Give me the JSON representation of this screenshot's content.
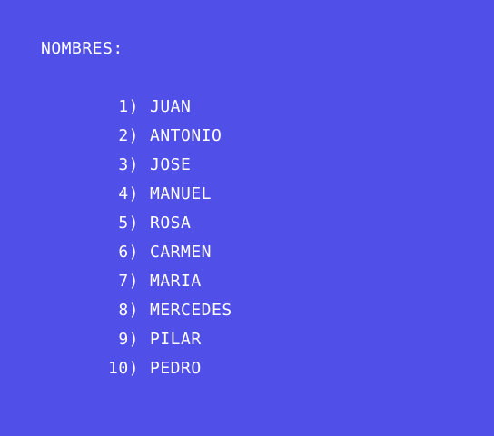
{
  "screen": {
    "heading": "NOMBRES:",
    "background_color": "#5050e8",
    "text_color": "#ffffff"
  },
  "names": [
    {
      "index": "1)",
      "name": "JUAN"
    },
    {
      "index": "2)",
      "name": "ANTONIO"
    },
    {
      "index": "3)",
      "name": "JOSE"
    },
    {
      "index": "4)",
      "name": "MANUEL"
    },
    {
      "index": "5)",
      "name": "ROSA"
    },
    {
      "index": "6)",
      "name": "CARMEN"
    },
    {
      "index": "7)",
      "name": "MARIA"
    },
    {
      "index": "8)",
      "name": "MERCEDES"
    },
    {
      "index": "9)",
      "name": "PILAR"
    },
    {
      "index": "10)",
      "name": "PEDRO"
    }
  ]
}
